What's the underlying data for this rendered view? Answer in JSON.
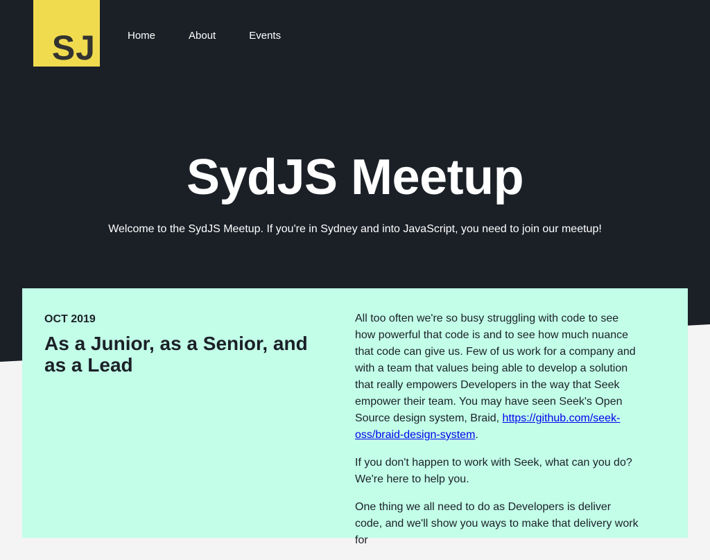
{
  "colors": {
    "hero_bg": "#1b2027",
    "logo_bg": "#f0db4f",
    "card_bg": "#c2fee8",
    "page_bg": "#f4f4f4",
    "link": "#0000ee"
  },
  "header": {
    "logo_text": "SJ",
    "nav": [
      {
        "label": "Home"
      },
      {
        "label": "About"
      },
      {
        "label": "Events"
      }
    ]
  },
  "hero": {
    "title": "SydJS Meetup",
    "subtitle": "Welcome to the SydJS Meetup. If you're in Sydney and into JavaScript, you need to join our meetup!"
  },
  "event": {
    "date": "OCT 2019",
    "title": "As a Junior, as a Senior, and as a Lead",
    "paragraph_1_text": "All too often we're so busy struggling with code to see how powerful that code is and to see how much nuance that code can give us. Few of us work for a company and with a team that values being able to develop a solution that really empowers Developers in the way that Seek empower their team. You may have seen Seek's Open Source design system, Braid, ",
    "paragraph_1_link": "https://github.com/seek-oss/braid-design-system",
    "paragraph_1_end": ".",
    "paragraph_2": "If you don't happen to work with Seek, what can you do? We're here to help you.",
    "paragraph_3": "One thing we all need to do as Developers is deliver code, and we'll show you ways to make that delivery work for"
  }
}
